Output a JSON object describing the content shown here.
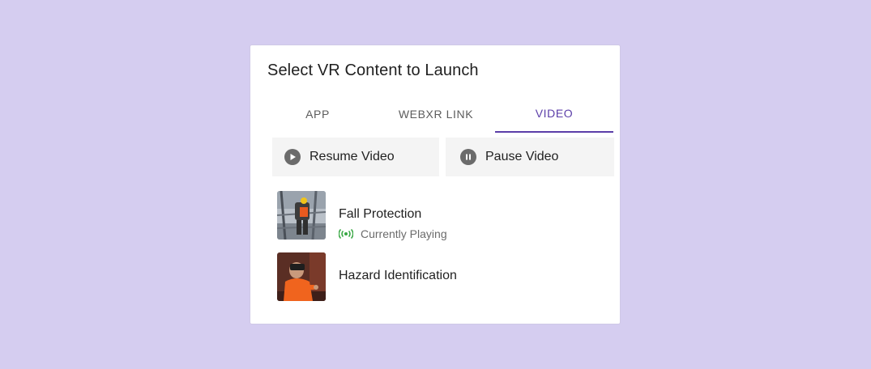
{
  "dialog": {
    "title": "Select VR Content to Launch"
  },
  "tabs": [
    {
      "label": "APP",
      "active": false
    },
    {
      "label": "WEBXR LINK",
      "active": false
    },
    {
      "label": "VIDEO",
      "active": true
    }
  ],
  "controls": {
    "resume_label": "Resume Video",
    "pause_label": "Pause Video"
  },
  "videos": [
    {
      "title": "Fall Protection",
      "status": "Currently Playing"
    },
    {
      "title": "Hazard Identification",
      "status": ""
    }
  ],
  "colors": {
    "background": "#d5cdf0",
    "accent": "#5b3ea8",
    "playing_indicator": "#3aa845"
  }
}
